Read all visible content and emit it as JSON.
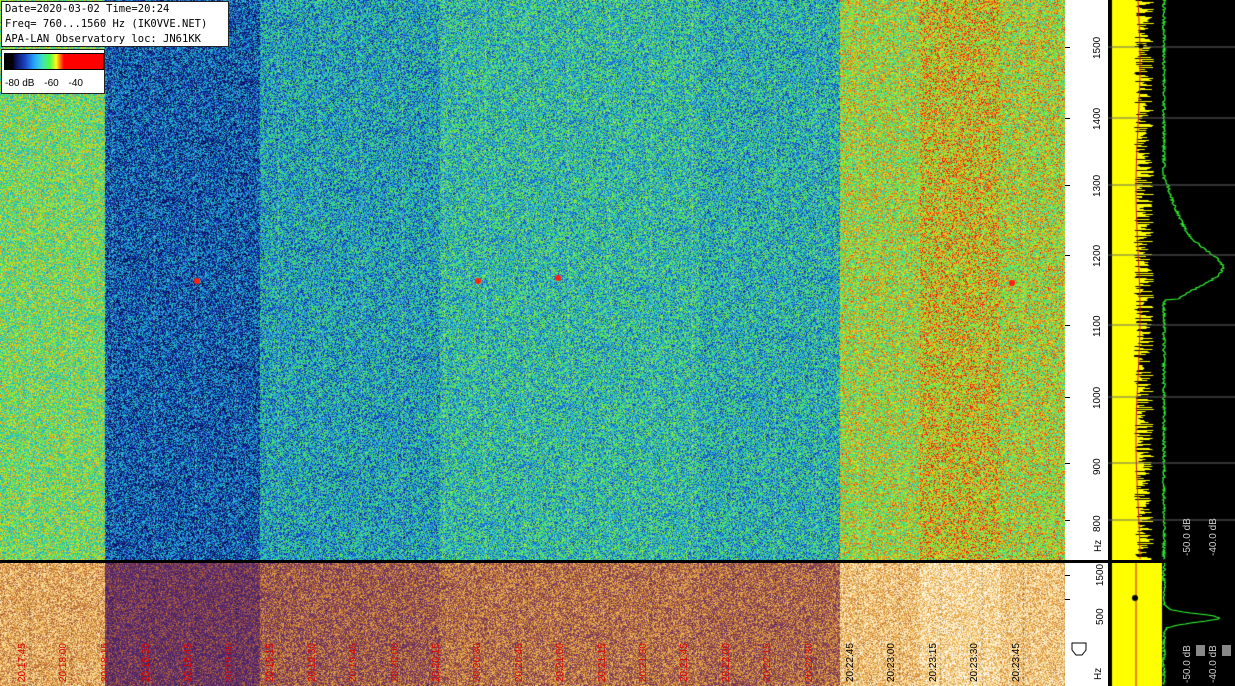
{
  "info": {
    "line1": "Date=2020-03-02 Time=20:24",
    "line2": "Freq= 760...1560 Hz (IK0VVE.NET)",
    "line3": "APA-LAN Observatory loc: JN61KK"
  },
  "scale": {
    "labels": [
      "-80 dB",
      "-60",
      "-40"
    ]
  },
  "axis_main": {
    "ticks": [
      "1500",
      "1400",
      "1300",
      "1200",
      "1100",
      "1000",
      "900",
      "800"
    ],
    "unit": "Hz"
  },
  "axis_lower": {
    "ticks": [
      "1500",
      "500"
    ],
    "unit": "Hz"
  },
  "spectrum": {
    "db_main": [
      "-50.0 dB",
      "-40.0 dB"
    ],
    "db_lower": [
      "-50.0 dB",
      "-40.0 dB"
    ]
  },
  "time_labels": [
    "20:17:45",
    "20:18:00",
    "20:18:15",
    "20:18:30",
    "20:18:45",
    "20:19:00",
    "20:19:15",
    "20:19:30",
    "20:19:45",
    "20:20:00",
    "20:20:15",
    "20:20:30",
    "20:20:45",
    "20:21:00",
    "20:21:15",
    "20:21:30",
    "20:21:45",
    "20:22:00",
    "20:22:15",
    "20:22:30",
    "20:22:45",
    "20:23:00",
    "20:23:15",
    "20:23:30",
    "20:23:45"
  ],
  "colors": {
    "waterfall_low": "#0a1a6e",
    "waterfall_mid": "#2aa8c8",
    "waterfall_high": "#7fe038",
    "lower_low": "#5a2a7a",
    "lower_high": "#f0c060",
    "spectrum_yellow": "#ffff00",
    "spectrum_green": "#33ff33",
    "time_red": "#e00000"
  }
}
